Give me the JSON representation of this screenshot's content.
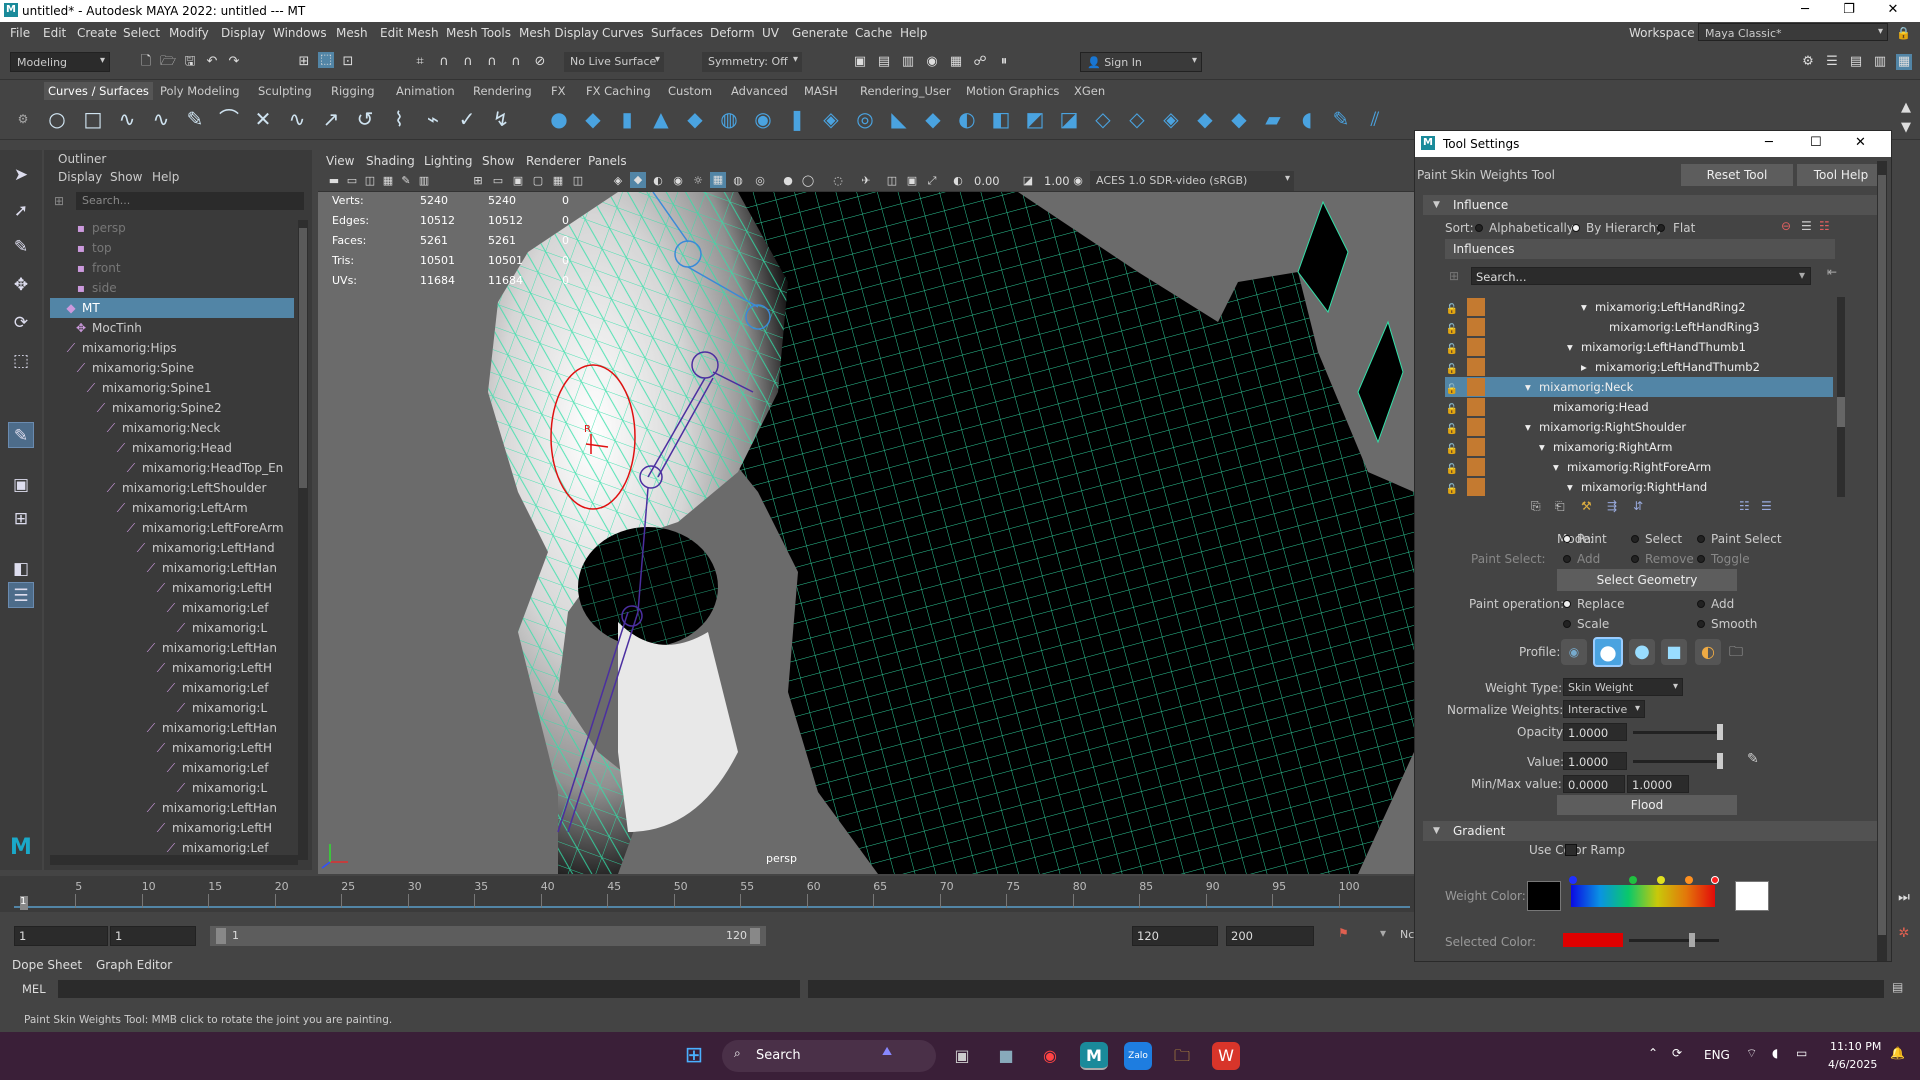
{
  "window": {
    "title": "untitled* - Autodesk MAYA 2022: untitled   ---   MT",
    "minimize": "─",
    "maximize": "❐",
    "close": "✕"
  },
  "menubar": [
    "File",
    "Edit",
    "Create",
    "Select",
    "Modify",
    "Display",
    "Windows",
    "Mesh",
    "Edit Mesh",
    "Mesh Tools",
    "Mesh Display",
    "Curves",
    "Surfaces",
    "Deform",
    "UV",
    "Generate",
    "Cache",
    "Help"
  ],
  "workspace": {
    "label": "Workspace :",
    "value": "Maya Classic*"
  },
  "toolbar": {
    "mode": "Modeling",
    "live_surface": "No Live Surface",
    "symmetry": "Symmetry: Off",
    "sign_in": "Sign In"
  },
  "shelf_tabs": [
    "Curves / Surfaces",
    "Poly Modeling",
    "Sculpting",
    "Rigging",
    "Animation",
    "Rendering",
    "FX",
    "FX Caching",
    "Custom",
    "Advanced",
    "MASH",
    "Rendering_User",
    "Motion Graphics",
    "XGen"
  ],
  "outliner": {
    "title": "Outliner",
    "menu": [
      "Display",
      "Show",
      "Help"
    ],
    "search_placeholder": "Search...",
    "rows": [
      {
        "label": "persp",
        "depth": 2,
        "type": "cam",
        "dim": true
      },
      {
        "label": "top",
        "depth": 2,
        "type": "cam",
        "dim": true
      },
      {
        "label": "front",
        "depth": 2,
        "type": "cam",
        "dim": true
      },
      {
        "label": "side",
        "depth": 2,
        "type": "cam",
        "dim": true
      },
      {
        "label": "MT",
        "depth": 1,
        "type": "mesh",
        "sel": true
      },
      {
        "label": "MocTinh",
        "depth": 2,
        "type": "node"
      },
      {
        "label": "mixamorig:Hips",
        "depth": 1,
        "type": "joint"
      },
      {
        "label": "mixamorig:Spine",
        "depth": 2,
        "type": "joint"
      },
      {
        "label": "mixamorig:Spine1",
        "depth": 3,
        "type": "joint"
      },
      {
        "label": "mixamorig:Spine2",
        "depth": 4,
        "type": "joint"
      },
      {
        "label": "mixamorig:Neck",
        "depth": 5,
        "type": "joint"
      },
      {
        "label": "mixamorig:Head",
        "depth": 6,
        "type": "joint"
      },
      {
        "label": "mixamorig:HeadTop_En",
        "depth": 7,
        "type": "joint"
      },
      {
        "label": "mixamorig:LeftShoulder",
        "depth": 5,
        "type": "joint"
      },
      {
        "label": "mixamorig:LeftArm",
        "depth": 6,
        "type": "joint"
      },
      {
        "label": "mixamorig:LeftForeArm",
        "depth": 7,
        "type": "joint"
      },
      {
        "label": "mixamorig:LeftHand",
        "depth": 8,
        "type": "joint"
      },
      {
        "label": "mixamorig:LeftHan",
        "depth": 9,
        "type": "joint"
      },
      {
        "label": "mixamorig:LeftH",
        "depth": 10,
        "type": "joint"
      },
      {
        "label": "mixamorig:Lef",
        "depth": 11,
        "type": "joint"
      },
      {
        "label": "mixamorig:L",
        "depth": 12,
        "type": "joint"
      },
      {
        "label": "mixamorig:LeftHan",
        "depth": 9,
        "type": "joint"
      },
      {
        "label": "mixamorig:LeftH",
        "depth": 10,
        "type": "joint"
      },
      {
        "label": "mixamorig:Lef",
        "depth": 11,
        "type": "joint"
      },
      {
        "label": "mixamorig:L",
        "depth": 12,
        "type": "joint"
      },
      {
        "label": "mixamorig:LeftHan",
        "depth": 9,
        "type": "joint"
      },
      {
        "label": "mixamorig:LeftH",
        "depth": 10,
        "type": "joint"
      },
      {
        "label": "mixamorig:Lef",
        "depth": 11,
        "type": "joint"
      },
      {
        "label": "mixamorig:L",
        "depth": 12,
        "type": "joint"
      },
      {
        "label": "mixamorig:LeftHan",
        "depth": 9,
        "type": "joint"
      },
      {
        "label": "mixamorig:LeftH",
        "depth": 10,
        "type": "joint"
      },
      {
        "label": "mixamorig:Lef",
        "depth": 11,
        "type": "joint"
      }
    ]
  },
  "viewport": {
    "menu": [
      "View",
      "Shading",
      "Lighting",
      "Show",
      "Renderer",
      "Panels"
    ],
    "exposure": "0.00",
    "gamma": "1.00",
    "colorspace": "ACES 1.0 SDR-video (sRGB)",
    "camera_label": "persp",
    "hud": [
      {
        "label": "Verts:",
        "a": "5240",
        "b": "5240",
        "c": "0"
      },
      {
        "label": "Edges:",
        "a": "10512",
        "b": "10512",
        "c": "0"
      },
      {
        "label": "Faces:",
        "a": "5261",
        "b": "5261",
        "c": "0"
      },
      {
        "label": "Tris:",
        "a": "10501",
        "b": "10501",
        "c": "0"
      },
      {
        "label": "UVs:",
        "a": "11684",
        "b": "11684",
        "c": "0"
      }
    ],
    "brush_label": "R"
  },
  "tool_settings": {
    "title": "Tool Settings",
    "tool_name": "Paint Skin Weights Tool",
    "reset": "Reset Tool",
    "help": "Tool Help",
    "influence_section": "Influence",
    "sort_label": "Sort:",
    "sort_options": [
      "Alphabetically",
      "By Hierarchy",
      "Flat"
    ],
    "influences_header": "Influences",
    "search_placeholder": "Search...",
    "influences": [
      {
        "label": "mixamorig:LeftHandRing2",
        "indent": 2,
        "arrow": "▾"
      },
      {
        "label": "mixamorig:LeftHandRing3",
        "indent": 3,
        "arrow": ""
      },
      {
        "label": "mixamorig:LeftHandThumb1",
        "indent": 1,
        "arrow": "▾"
      },
      {
        "label": "mixamorig:LeftHandThumb2",
        "indent": 2,
        "arrow": "▸"
      },
      {
        "label": "mixamorig:Neck",
        "indent": -2,
        "arrow": "▾",
        "sel": true
      },
      {
        "label": "mixamorig:Head",
        "indent": -1,
        "arrow": ""
      },
      {
        "label": "mixamorig:RightShoulder",
        "indent": -2,
        "arrow": "▾"
      },
      {
        "label": "mixamorig:RightArm",
        "indent": -1,
        "arrow": "▾"
      },
      {
        "label": "mixamorig:RightForeArm",
        "indent": 0,
        "arrow": "▾"
      },
      {
        "label": "mixamorig:RightHand",
        "indent": 1,
        "arrow": "▾"
      }
    ],
    "mode_label": "Mode:",
    "mode_options": [
      "Paint",
      "Select",
      "Paint Select"
    ],
    "paint_select_label": "Paint Select:",
    "paint_select_options": [
      "Add",
      "Remove",
      "Toggle"
    ],
    "select_geometry": "Select Geometry",
    "paint_op_label": "Paint operation:",
    "paint_ops": [
      "Replace",
      "Add",
      "Scale",
      "Smooth"
    ],
    "profile_label": "Profile:",
    "weight_type_label": "Weight Type:",
    "weight_type": "Skin Weight",
    "normalize_label": "Normalize Weights:",
    "normalize": "Interactive",
    "opacity_label": "Opacity:",
    "opacity": "1.0000",
    "value_label": "Value:",
    "value": "1.0000",
    "minmax_label": "Min/Max value:",
    "min": "0.0000",
    "max": "1.0000",
    "flood": "Flood",
    "gradient_section": "Gradient",
    "use_color_ramp": "Use Color Ramp",
    "weight_color_label": "Weight Color:",
    "selected_color_label": "Selected Color:",
    "selected_color": "#e00000"
  },
  "timeline": {
    "ticks": [
      "5",
      "10",
      "15",
      "20",
      "25",
      "30",
      "35",
      "40",
      "45",
      "50",
      "55",
      "60",
      "65",
      "70",
      "75",
      "80",
      "85",
      "90",
      "95",
      "100"
    ],
    "current": "1"
  },
  "range": {
    "start": "1",
    "start2": "1",
    "slider_start": "1",
    "slider_end": "120",
    "end": "120",
    "end2": "200",
    "extra": "Nc"
  },
  "bottom_tabs": [
    "Dope Sheet",
    "Graph Editor"
  ],
  "mel_label": "MEL",
  "status_text": "Paint Skin Weights Tool: MMB click to rotate the joint you are painting.",
  "taskbar": {
    "search": "Search",
    "lang": "ENG",
    "time": "11:10 PM",
    "date": "4/6/2025"
  }
}
